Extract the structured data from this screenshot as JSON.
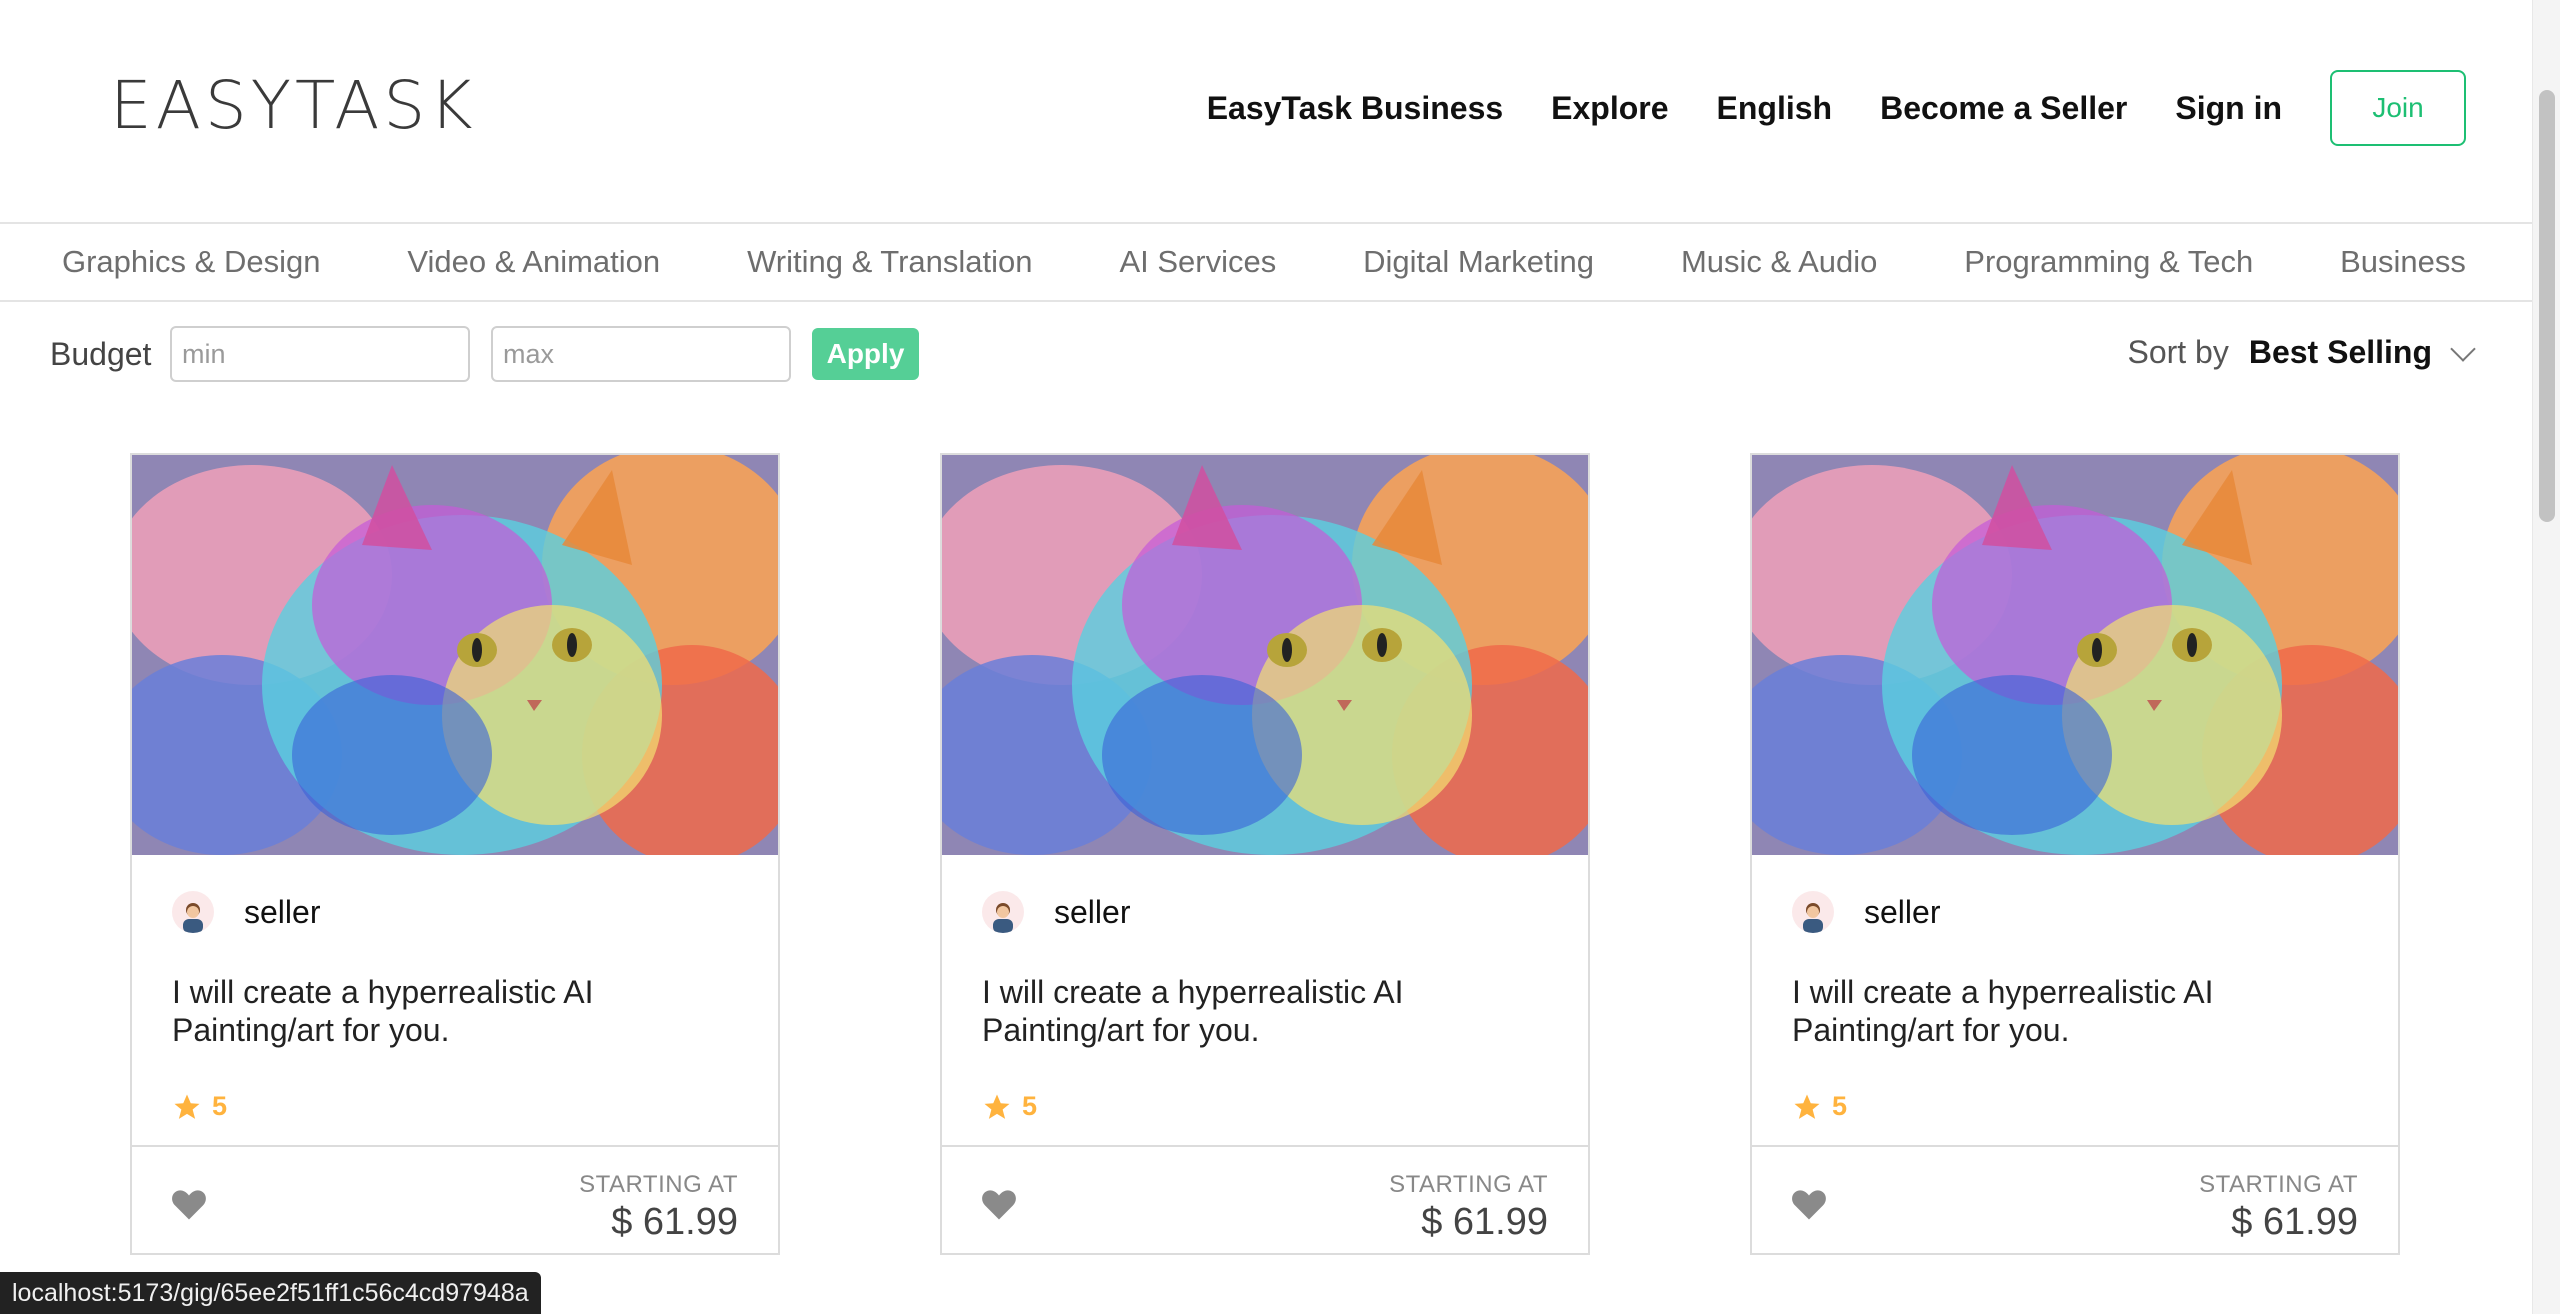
{
  "header": {
    "logo": "EASYTASK",
    "nav": [
      "EasyTask Business",
      "Explore",
      "English",
      "Become a Seller",
      "Sign in"
    ],
    "join_label": "Join"
  },
  "categories": [
    "Graphics & Design",
    "Video & Animation",
    "Writing & Translation",
    "AI Services",
    "Digital Marketing",
    "Music & Audio",
    "Programming & Tech",
    "Business"
  ],
  "filters": {
    "budget_label": "Budget",
    "min_placeholder": "min",
    "max_placeholder": "max",
    "apply_label": "Apply",
    "sort_label": "Sort by",
    "sort_value": "Best Selling"
  },
  "gigs": [
    {
      "seller": "seller",
      "title": "I will create a hyperrealistic AI Painting/art for you.",
      "rating": "5",
      "starting_at": "STARTING AT",
      "price": "$ 61.99"
    },
    {
      "seller": "seller",
      "title": "I will create a hyperrealistic AI Painting/art for you.",
      "rating": "5",
      "starting_at": "STARTING AT",
      "price": "$ 61.99"
    },
    {
      "seller": "seller",
      "title": "I will create a hyperrealistic AI Painting/art for you.",
      "rating": "5",
      "starting_at": "STARTING AT",
      "price": "$ 61.99"
    }
  ],
  "status_url": "localhost:5173/gig/65ee2f51ff1c56c4cd97948a",
  "colors": {
    "accent": "#1dbf73",
    "star": "#ffb33e",
    "heart": "#8a8a8a"
  }
}
